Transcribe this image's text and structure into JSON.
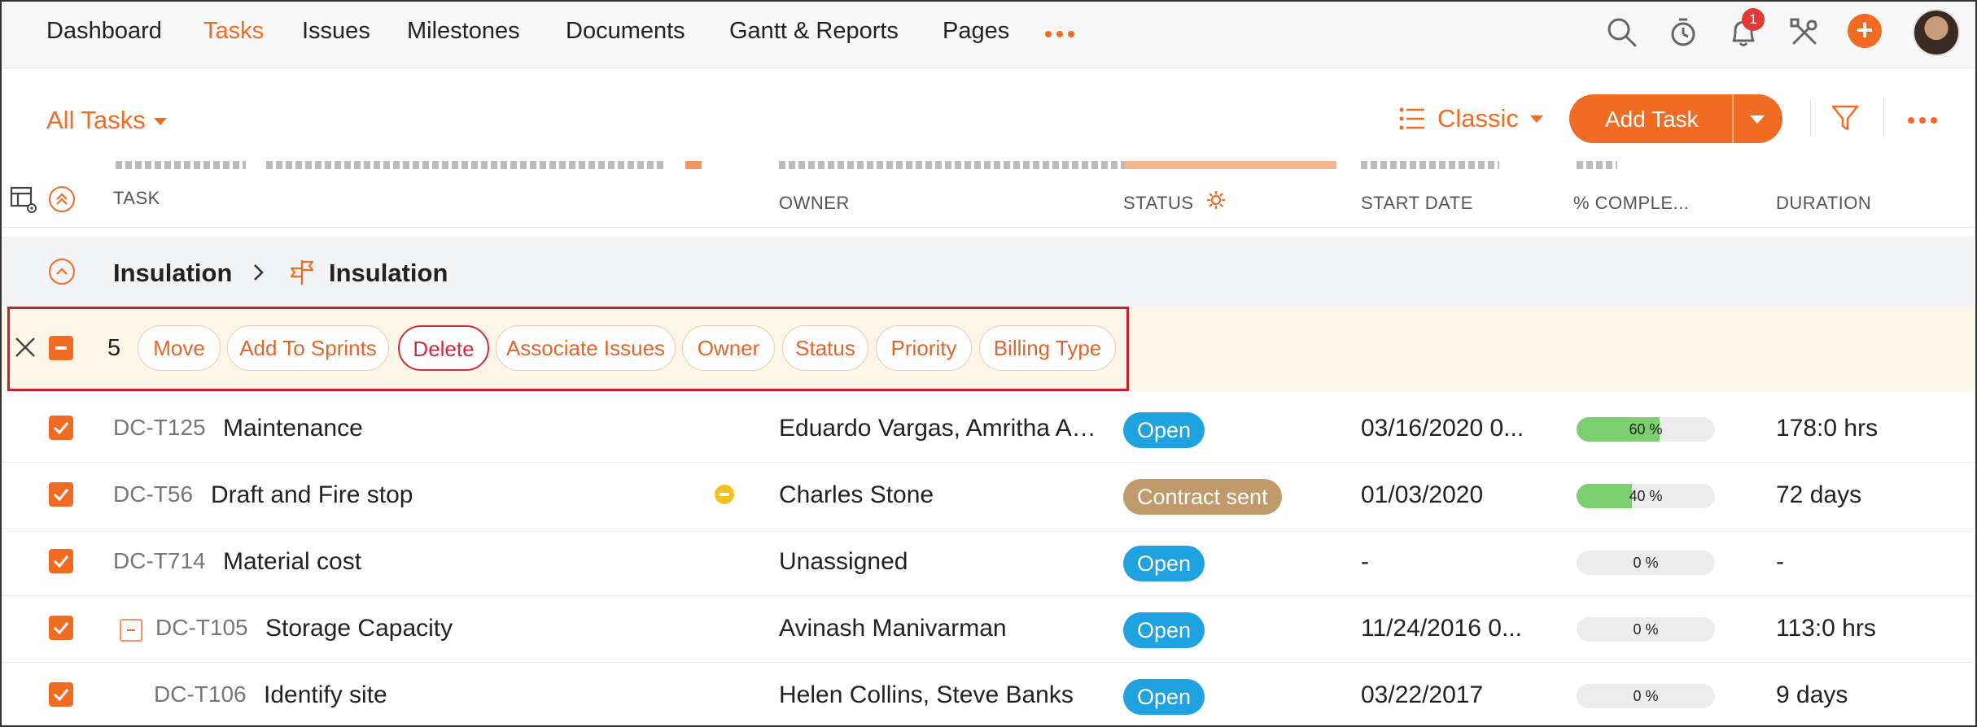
{
  "nav": {
    "items": [
      "Dashboard",
      "Tasks",
      "Issues",
      "Milestones",
      "Documents",
      "Gantt & Reports",
      "Pages"
    ],
    "active": "Tasks",
    "notification_count": "1",
    "icons": [
      "search-icon",
      "timer-icon",
      "bell-icon",
      "tools-icon",
      "plus-icon",
      "avatar"
    ]
  },
  "toolbar": {
    "view_filter": "All Tasks",
    "layout": "Classic",
    "add_task": "Add Task"
  },
  "table": {
    "headers": {
      "task": "TASK",
      "owner": "OWNER",
      "status": "STATUS",
      "start_date": "START DATE",
      "percent": "% COMPLE...",
      "duration": "DURATION"
    }
  },
  "group": {
    "parent": "Insulation",
    "child": "Insulation"
  },
  "bulk": {
    "count": "5",
    "actions": [
      "Move",
      "Add To Sprints",
      "Delete",
      "Associate Issues",
      "Owner",
      "Status",
      "Priority",
      "Billing Type"
    ]
  },
  "rows": [
    {
      "id": "DC-T125",
      "name": "Maintenance",
      "owner": "Eduardo Vargas, Amritha Ag...",
      "status": "Open",
      "start": "03/16/2020 0...",
      "percent": 60,
      "percent_label": "60 %",
      "duration": "178:0 hrs"
    },
    {
      "id": "DC-T56",
      "name": "Draft and Fire stop",
      "owner": "Charles Stone",
      "status": "Contract sent",
      "start": "01/03/2020",
      "percent": 40,
      "percent_label": "40 %",
      "duration": "72 days"
    },
    {
      "id": "DC-T714",
      "name": "Material cost",
      "owner": "Unassigned",
      "status": "Open",
      "start": "-",
      "percent": 0,
      "percent_label": "0 %",
      "duration": "-"
    },
    {
      "id": "DC-T105",
      "name": "Storage Capacity",
      "owner": "Avinash Manivarman",
      "status": "Open",
      "start": "11/24/2016 0...",
      "percent": 0,
      "percent_label": "0 %",
      "duration": "113:0 hrs"
    },
    {
      "id": "DC-T106",
      "name": "Identify site",
      "owner": "Helen Collins, Steve Banks",
      "status": "Open",
      "start": "03/22/2017",
      "percent": 0,
      "percent_label": "0 %",
      "duration": "9 days"
    }
  ],
  "colors": {
    "accent": "#f26b22",
    "status_open": "#1fa3e0",
    "status_contract_sent": "#c19a6b",
    "progress_fill": "#7ccf6f",
    "danger": "#d22b3d"
  }
}
